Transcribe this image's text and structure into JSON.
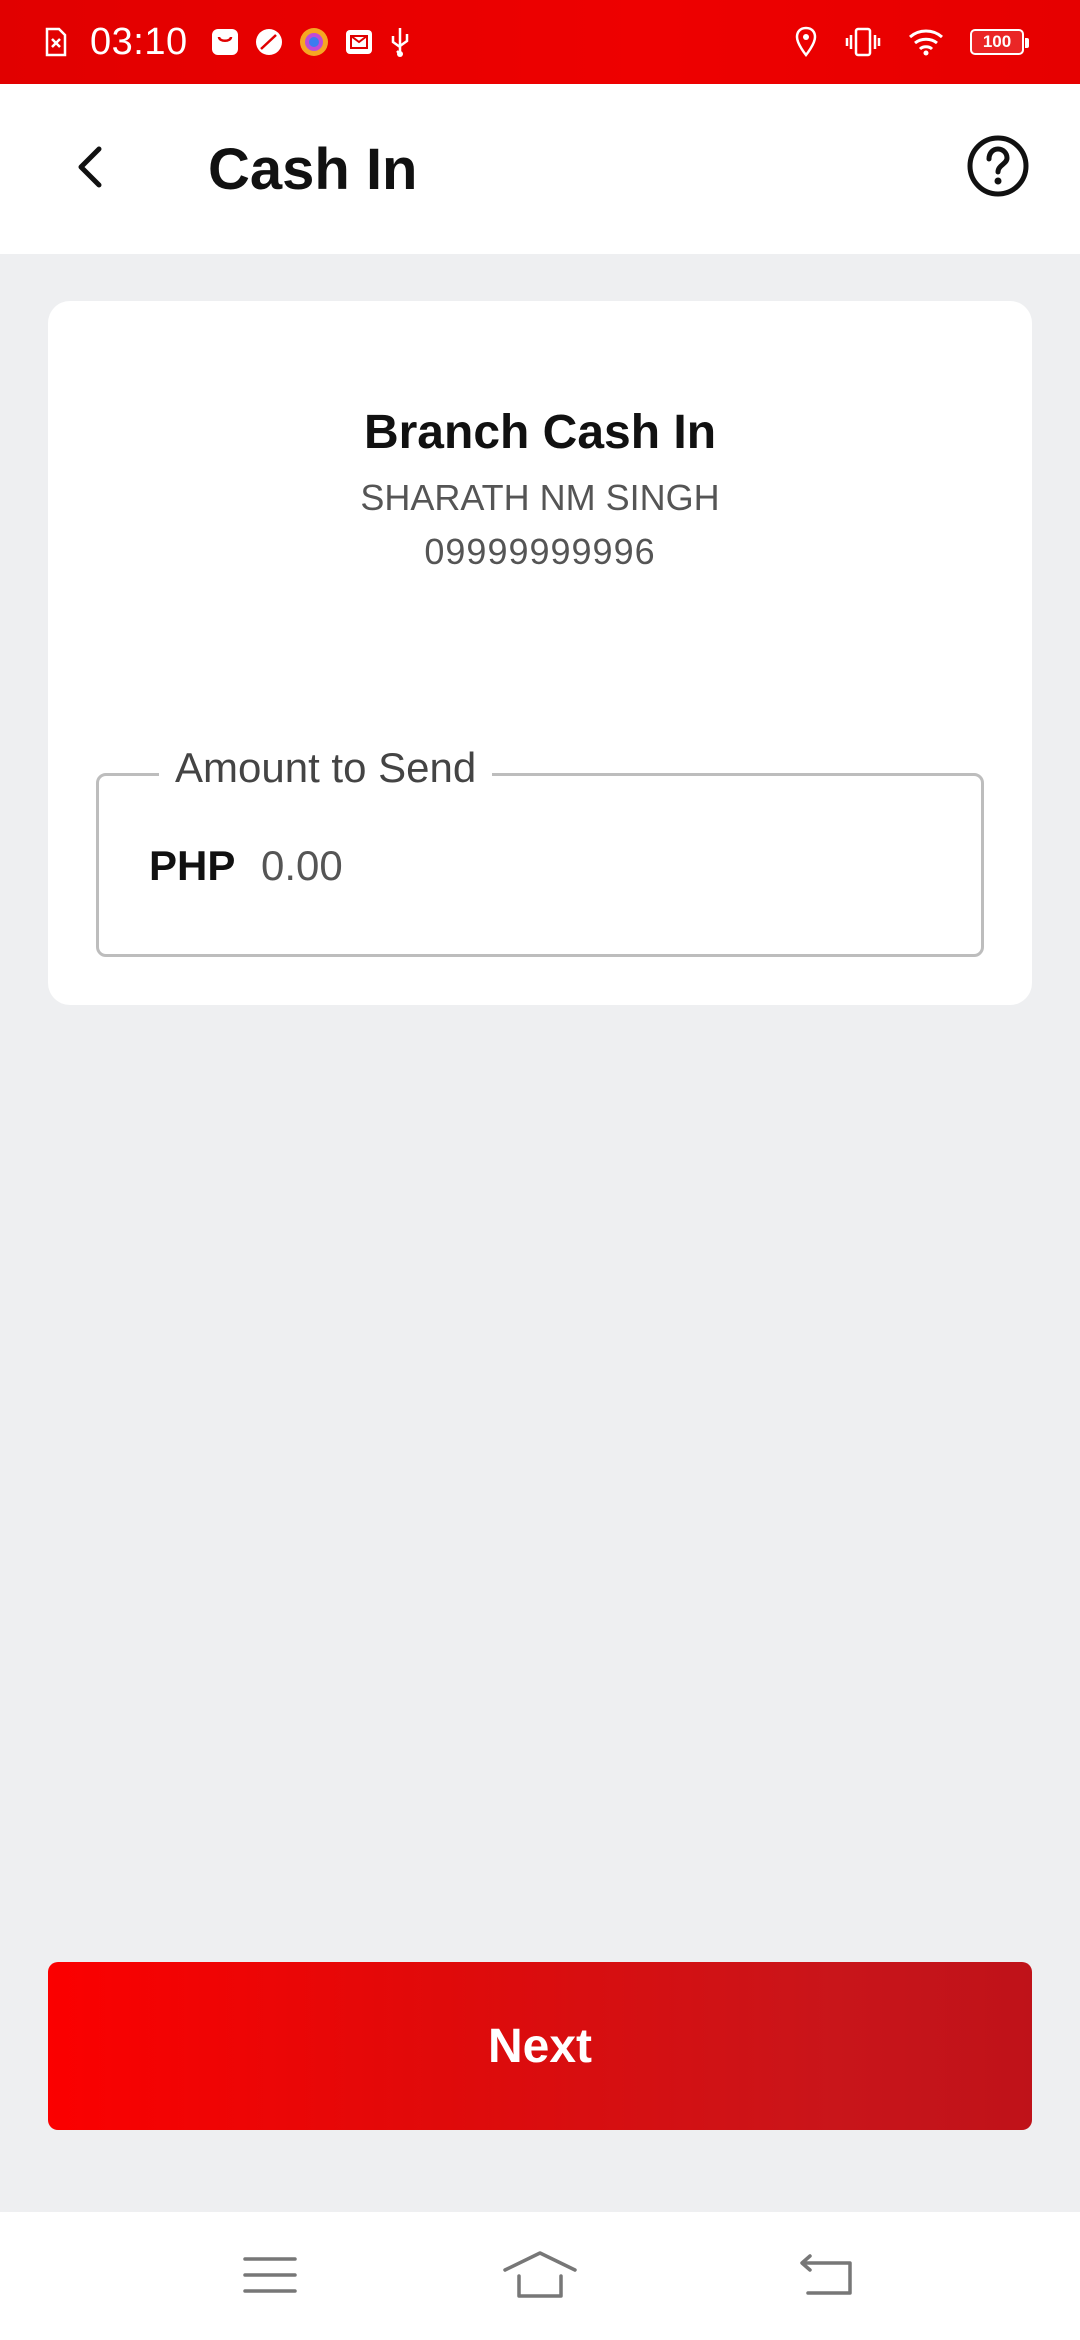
{
  "status_bar": {
    "time": "03:10",
    "battery": "100",
    "left_icons": [
      "sim-error-icon",
      "shopping-bag-icon",
      "leaf-app-icon",
      "browser-icon",
      "mail-icon",
      "usb-icon"
    ],
    "right_icons": [
      "location-icon",
      "vibrate-icon",
      "wifi-icon",
      "battery-icon"
    ]
  },
  "header": {
    "title": "Cash In",
    "back_icon": "chevron-left-icon",
    "help_icon": "help-circle-icon"
  },
  "card": {
    "title": "Branch Cash In",
    "name": "SHARATH NM SINGH",
    "number": "09999999996",
    "amount_field": {
      "label": "Amount to Send",
      "currency": "PHP",
      "value": "",
      "placeholder": "0.00"
    }
  },
  "actions": {
    "next_label": "Next"
  },
  "nav_bar": {
    "items": [
      "menu-icon",
      "home-icon",
      "back-icon"
    ]
  },
  "colors": {
    "brand_red": "#ee0000",
    "background": "#eeeff1"
  }
}
